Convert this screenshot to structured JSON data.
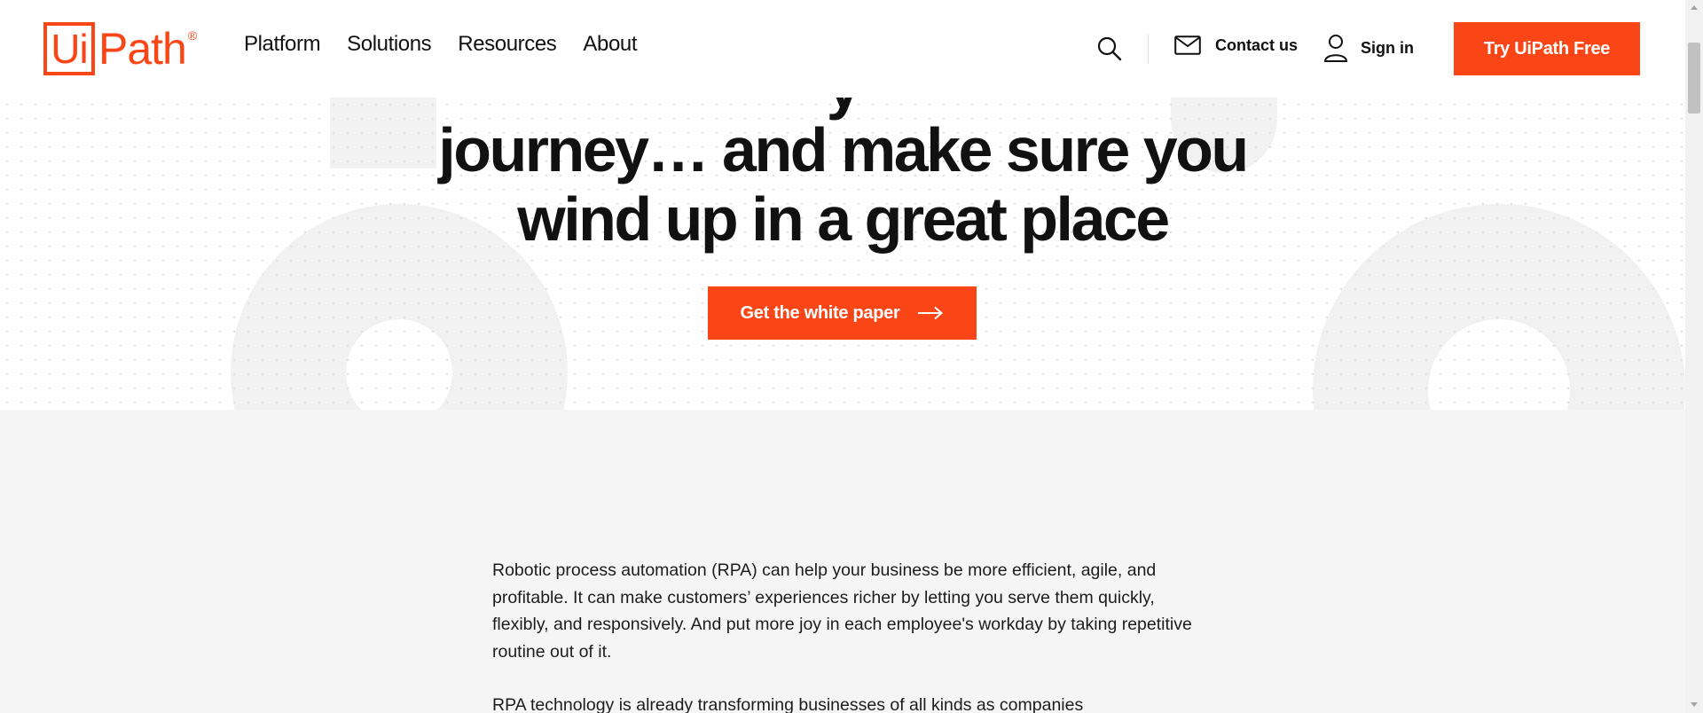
{
  "header": {
    "logo_box": "Ui",
    "logo_rest": "Path",
    "logo_reg": "®",
    "nav": [
      "Platform",
      "Solutions",
      "Resources",
      "About"
    ],
    "contact_label": "Contact us",
    "signin_label": "Sign in",
    "try_label": "Try UiPath Free"
  },
  "hero": {
    "title_partial": "y",
    "title_line1": "journey… and make sure you",
    "title_line2": "wind up in a great place",
    "cta_label": "Get the white paper"
  },
  "content": {
    "paragraph1": "Robotic process automation (RPA) can help your business be more efficient, agile, and profitable. It can make customers’ experiences richer by letting you serve them quickly, flexibly, and responsively. And put more joy in each employee's workday by taking repetitive routine out of it.",
    "paragraph2": "RPA technology is already transforming businesses of all kinds as companies"
  },
  "colors": {
    "brand": "#fa4616",
    "background": "#f5f5f5"
  },
  "icons": [
    "search-icon",
    "mail-icon",
    "user-icon",
    "arrow-right-icon"
  ]
}
